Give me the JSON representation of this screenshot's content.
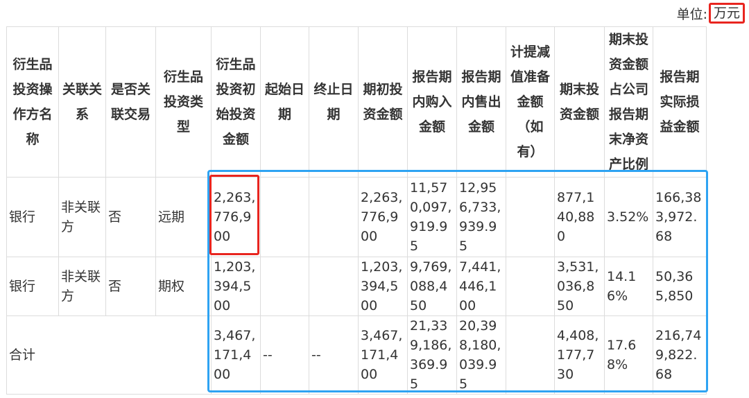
{
  "unit": {
    "label": "单位:",
    "value": "万元"
  },
  "table": {
    "headers": [
      "衍生品投资操作方名称",
      "关联关系",
      "是否关联交易",
      "衍生品投资类型",
      "衍生品投资初始投资金额",
      "起始日期",
      "终止日期",
      "期初投资金额",
      "报告期内购入金额",
      "报告期内售出金额",
      "计提减值准备金额（如有）",
      "期末投资金额",
      "期末投资金额占公司报告期末净资产比例",
      "报告期实际损益金额"
    ],
    "rows": [
      [
        "银行",
        "非关联方",
        "否",
        "远期",
        "2,263,776,900",
        "",
        "",
        "2,263,776,900",
        "11,570,097,919.95",
        "12,956,733,939.95",
        "",
        "877,140,880",
        "3.52%",
        "166,383,972.68"
      ],
      [
        "银行",
        "非关联方",
        "否",
        "期权",
        "1,203,394,500",
        "",
        "",
        "1,203,394,500",
        "9,769,088,450",
        "7,441,446,100",
        "",
        "3,531,036,850",
        "14.16%",
        "50,365,850"
      ]
    ],
    "total": [
      "合计",
      "3,467,171,400",
      "--",
      "--",
      "3,467,171,400",
      "21,339,186,369.95",
      "20,398,180,039.95",
      "",
      "4,408,177,730",
      "17.68%",
      "216,749,822.68"
    ]
  },
  "colors": {
    "highlight_red": "#e8251f",
    "highlight_blue": "#2ea3f2",
    "grid": "#dcdcdc",
    "text": "#333333"
  }
}
